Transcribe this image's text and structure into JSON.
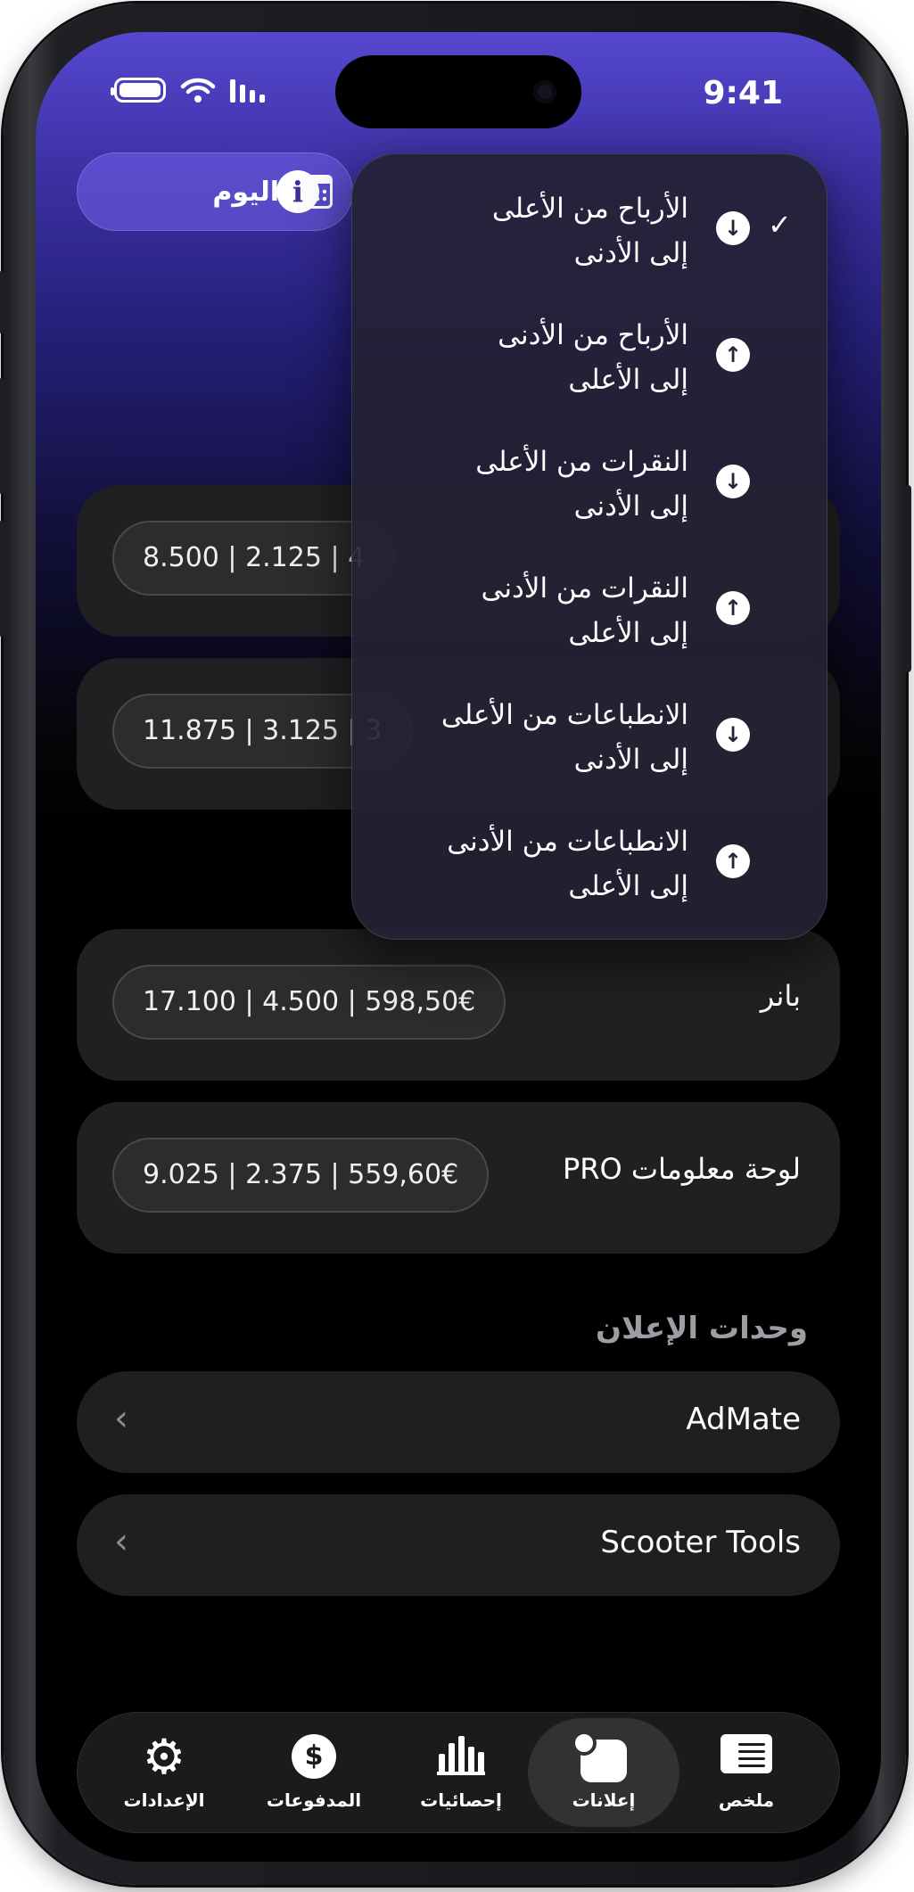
{
  "status_bar": {
    "time": "9:41"
  },
  "header": {
    "date_filter_label": "اليوم"
  },
  "sort_menu": {
    "items": [
      {
        "line1": "الأرباح من الأعلى",
        "line2": "إلى الأدنى",
        "direction": "down",
        "selected": true
      },
      {
        "line1": "الأرباح من الأدنى",
        "line2": "إلى الأعلى",
        "direction": "up",
        "selected": false
      },
      {
        "line1": "النقرات من الأعلى",
        "line2": "إلى الأدنى",
        "direction": "down",
        "selected": false
      },
      {
        "line1": "النقرات من الأدنى",
        "line2": "إلى الأعلى",
        "direction": "up",
        "selected": false
      },
      {
        "line1": "الانطباعات من الأعلى",
        "line2": "إلى الأدنى",
        "direction": "down",
        "selected": false
      },
      {
        "line1": "الانطباعات من الأدنى",
        "line2": "إلى الأعلى",
        "direction": "up",
        "selected": false
      }
    ]
  },
  "ad_cards": [
    {
      "label": "",
      "value": "8.500 | 2.125 | 4"
    },
    {
      "label": "",
      "value": "11.875 | 3.125 | 3"
    },
    {
      "label": "بانر",
      "value": "17.100 | 4.500 | 598,50€"
    },
    {
      "label": "لوحة معلومات PRO",
      "value": "9.025 | 2.375 | 559,60€"
    }
  ],
  "ad_units": {
    "section_title": "وحدات الإعلان",
    "items": [
      {
        "label": "AdMate"
      },
      {
        "label": "Scooter Tools"
      }
    ]
  },
  "tab_bar": {
    "active": "ads",
    "tabs": [
      {
        "id": "settings",
        "label": "الإعدادات",
        "icon": "gear-icon"
      },
      {
        "id": "payments",
        "label": "المدفوعات",
        "icon": "dollar-icon"
      },
      {
        "id": "stats",
        "label": "إحصائيات",
        "icon": "bar-chart-icon"
      },
      {
        "id": "ads",
        "label": "إعلانات",
        "icon": "ads-icon"
      },
      {
        "id": "summary",
        "label": "ملخص",
        "icon": "summary-icon"
      }
    ]
  },
  "colors": {
    "header_gradient_top": "#5548cf",
    "card_bg": "#202022",
    "menu_bg": "#242234"
  }
}
